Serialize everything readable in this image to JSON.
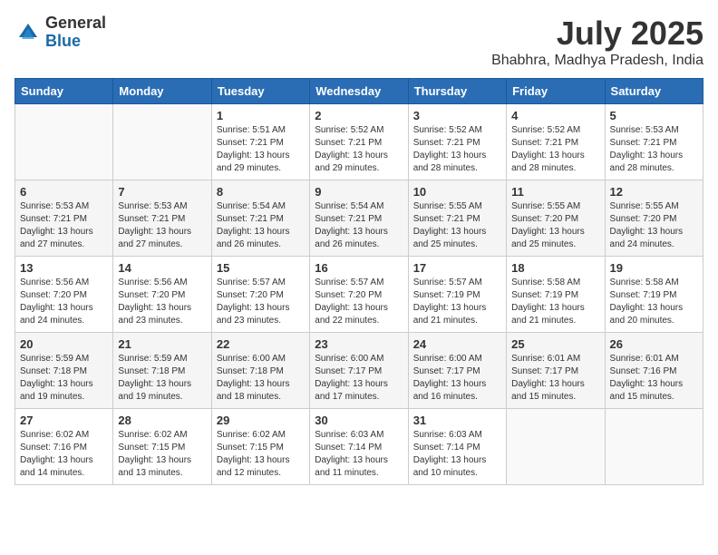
{
  "logo": {
    "general": "General",
    "blue": "Blue"
  },
  "title": "July 2025",
  "location": "Bhabhra, Madhya Pradesh, India",
  "days_of_week": [
    "Sunday",
    "Monday",
    "Tuesday",
    "Wednesday",
    "Thursday",
    "Friday",
    "Saturday"
  ],
  "weeks": [
    [
      {
        "day": "",
        "info": ""
      },
      {
        "day": "",
        "info": ""
      },
      {
        "day": "1",
        "info": "Sunrise: 5:51 AM\nSunset: 7:21 PM\nDaylight: 13 hours and 29 minutes."
      },
      {
        "day": "2",
        "info": "Sunrise: 5:52 AM\nSunset: 7:21 PM\nDaylight: 13 hours and 29 minutes."
      },
      {
        "day": "3",
        "info": "Sunrise: 5:52 AM\nSunset: 7:21 PM\nDaylight: 13 hours and 28 minutes."
      },
      {
        "day": "4",
        "info": "Sunrise: 5:52 AM\nSunset: 7:21 PM\nDaylight: 13 hours and 28 minutes."
      },
      {
        "day": "5",
        "info": "Sunrise: 5:53 AM\nSunset: 7:21 PM\nDaylight: 13 hours and 28 minutes."
      }
    ],
    [
      {
        "day": "6",
        "info": "Sunrise: 5:53 AM\nSunset: 7:21 PM\nDaylight: 13 hours and 27 minutes."
      },
      {
        "day": "7",
        "info": "Sunrise: 5:53 AM\nSunset: 7:21 PM\nDaylight: 13 hours and 27 minutes."
      },
      {
        "day": "8",
        "info": "Sunrise: 5:54 AM\nSunset: 7:21 PM\nDaylight: 13 hours and 26 minutes."
      },
      {
        "day": "9",
        "info": "Sunrise: 5:54 AM\nSunset: 7:21 PM\nDaylight: 13 hours and 26 minutes."
      },
      {
        "day": "10",
        "info": "Sunrise: 5:55 AM\nSunset: 7:21 PM\nDaylight: 13 hours and 25 minutes."
      },
      {
        "day": "11",
        "info": "Sunrise: 5:55 AM\nSunset: 7:20 PM\nDaylight: 13 hours and 25 minutes."
      },
      {
        "day": "12",
        "info": "Sunrise: 5:55 AM\nSunset: 7:20 PM\nDaylight: 13 hours and 24 minutes."
      }
    ],
    [
      {
        "day": "13",
        "info": "Sunrise: 5:56 AM\nSunset: 7:20 PM\nDaylight: 13 hours and 24 minutes."
      },
      {
        "day": "14",
        "info": "Sunrise: 5:56 AM\nSunset: 7:20 PM\nDaylight: 13 hours and 23 minutes."
      },
      {
        "day": "15",
        "info": "Sunrise: 5:57 AM\nSunset: 7:20 PM\nDaylight: 13 hours and 23 minutes."
      },
      {
        "day": "16",
        "info": "Sunrise: 5:57 AM\nSunset: 7:20 PM\nDaylight: 13 hours and 22 minutes."
      },
      {
        "day": "17",
        "info": "Sunrise: 5:57 AM\nSunset: 7:19 PM\nDaylight: 13 hours and 21 minutes."
      },
      {
        "day": "18",
        "info": "Sunrise: 5:58 AM\nSunset: 7:19 PM\nDaylight: 13 hours and 21 minutes."
      },
      {
        "day": "19",
        "info": "Sunrise: 5:58 AM\nSunset: 7:19 PM\nDaylight: 13 hours and 20 minutes."
      }
    ],
    [
      {
        "day": "20",
        "info": "Sunrise: 5:59 AM\nSunset: 7:18 PM\nDaylight: 13 hours and 19 minutes."
      },
      {
        "day": "21",
        "info": "Sunrise: 5:59 AM\nSunset: 7:18 PM\nDaylight: 13 hours and 19 minutes."
      },
      {
        "day": "22",
        "info": "Sunrise: 6:00 AM\nSunset: 7:18 PM\nDaylight: 13 hours and 18 minutes."
      },
      {
        "day": "23",
        "info": "Sunrise: 6:00 AM\nSunset: 7:17 PM\nDaylight: 13 hours and 17 minutes."
      },
      {
        "day": "24",
        "info": "Sunrise: 6:00 AM\nSunset: 7:17 PM\nDaylight: 13 hours and 16 minutes."
      },
      {
        "day": "25",
        "info": "Sunrise: 6:01 AM\nSunset: 7:17 PM\nDaylight: 13 hours and 15 minutes."
      },
      {
        "day": "26",
        "info": "Sunrise: 6:01 AM\nSunset: 7:16 PM\nDaylight: 13 hours and 15 minutes."
      }
    ],
    [
      {
        "day": "27",
        "info": "Sunrise: 6:02 AM\nSunset: 7:16 PM\nDaylight: 13 hours and 14 minutes."
      },
      {
        "day": "28",
        "info": "Sunrise: 6:02 AM\nSunset: 7:15 PM\nDaylight: 13 hours and 13 minutes."
      },
      {
        "day": "29",
        "info": "Sunrise: 6:02 AM\nSunset: 7:15 PM\nDaylight: 13 hours and 12 minutes."
      },
      {
        "day": "30",
        "info": "Sunrise: 6:03 AM\nSunset: 7:14 PM\nDaylight: 13 hours and 11 minutes."
      },
      {
        "day": "31",
        "info": "Sunrise: 6:03 AM\nSunset: 7:14 PM\nDaylight: 13 hours and 10 minutes."
      },
      {
        "day": "",
        "info": ""
      },
      {
        "day": "",
        "info": ""
      }
    ]
  ]
}
